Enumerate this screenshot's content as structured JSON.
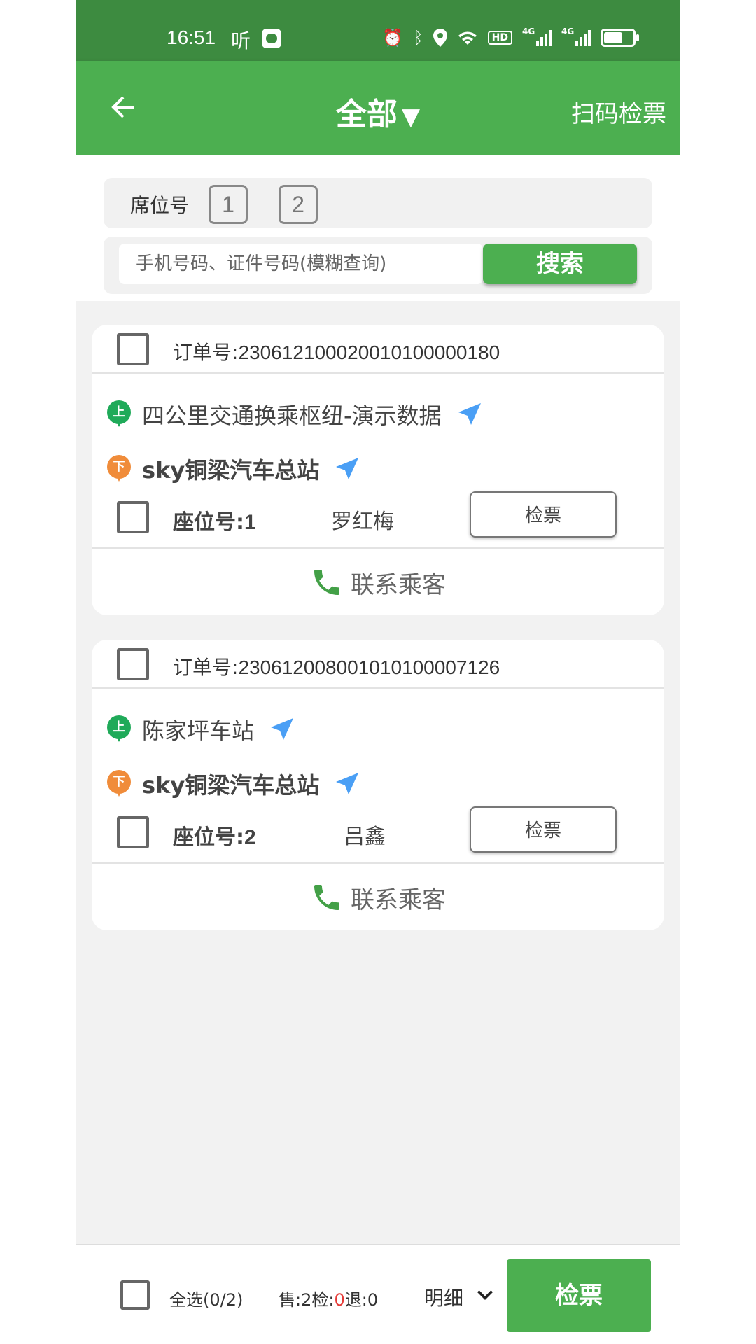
{
  "status_bar": {
    "time": "16:51",
    "ting": "听",
    "hd": "HD",
    "net1": "4G",
    "net2": "4G",
    "battery_level": 0.65
  },
  "header": {
    "title": "全部",
    "caret": "▼",
    "scan_label": "扫码检票"
  },
  "filter": {
    "seat_label": "席位号",
    "seats": [
      "1",
      "2"
    ],
    "search_placeholder": "手机号码、证件号码(模糊查询)",
    "search_label": "搜索"
  },
  "orders": [
    {
      "order_label": "订单号:",
      "order_no": "230612100020010100000180",
      "board_badge": "上",
      "board_stop": "四公里交通换乘枢纽-演示数据",
      "alight_badge": "下",
      "alight_stop": "sky铜梁汽车总站",
      "seat_label": "座位号:",
      "seat_no": "1",
      "passenger": "罗红梅",
      "check_label": "检票",
      "contact_label": "联系乘客"
    },
    {
      "order_label": "订单号:",
      "order_no": "230612008001010100007126",
      "board_badge": "上",
      "board_stop": "陈家坪车站",
      "alight_badge": "下",
      "alight_stop": "sky铜梁汽车总站",
      "seat_label": "座位号:",
      "seat_no": "2",
      "passenger": "吕鑫",
      "check_label": "检票",
      "contact_label": "联系乘客"
    }
  ],
  "bottom": {
    "select_all": "全选(0/2)",
    "sold_label": "售:",
    "sold": "2",
    "checked_label": "检:",
    "checked": "0",
    "refund_label": "退:",
    "refund": "0",
    "detail_label": "明细",
    "check_button": "检票"
  },
  "colors": {
    "primary": "#4caf50",
    "status_bar": "#3d8b40",
    "board_pin": "#1faa59",
    "alight_pin": "#f08c3a",
    "nav_arrow": "#4a9ff5",
    "checked_count": "#e53935"
  }
}
